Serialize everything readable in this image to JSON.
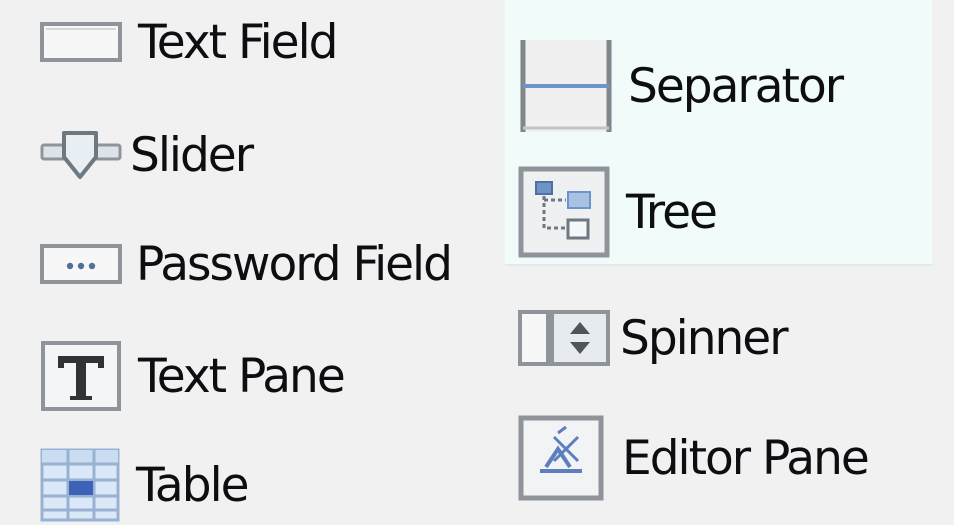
{
  "palette": {
    "left_column": [
      {
        "label": "Text Field",
        "icon": "text-field-icon"
      },
      {
        "label": "Slider",
        "icon": "slider-icon"
      },
      {
        "label": "Password Field",
        "icon": "password-field-icon"
      },
      {
        "label": "Text Pane",
        "icon": "text-pane-icon"
      },
      {
        "label": "Table",
        "icon": "table-icon"
      }
    ],
    "right_column": [
      {
        "label": "Separator",
        "icon": "separator-icon"
      },
      {
        "label": "Tree",
        "icon": "tree-icon"
      },
      {
        "label": "Spinner",
        "icon": "spinner-icon"
      },
      {
        "label": "Editor Pane",
        "icon": "editor-pane-icon"
      }
    ]
  },
  "colors": {
    "background": "#f1f1f1",
    "canvas": "#f0fbfa",
    "text": "#0e0e12",
    "icon_border": "#8e9499",
    "accent_blue": "#6e93c8"
  }
}
